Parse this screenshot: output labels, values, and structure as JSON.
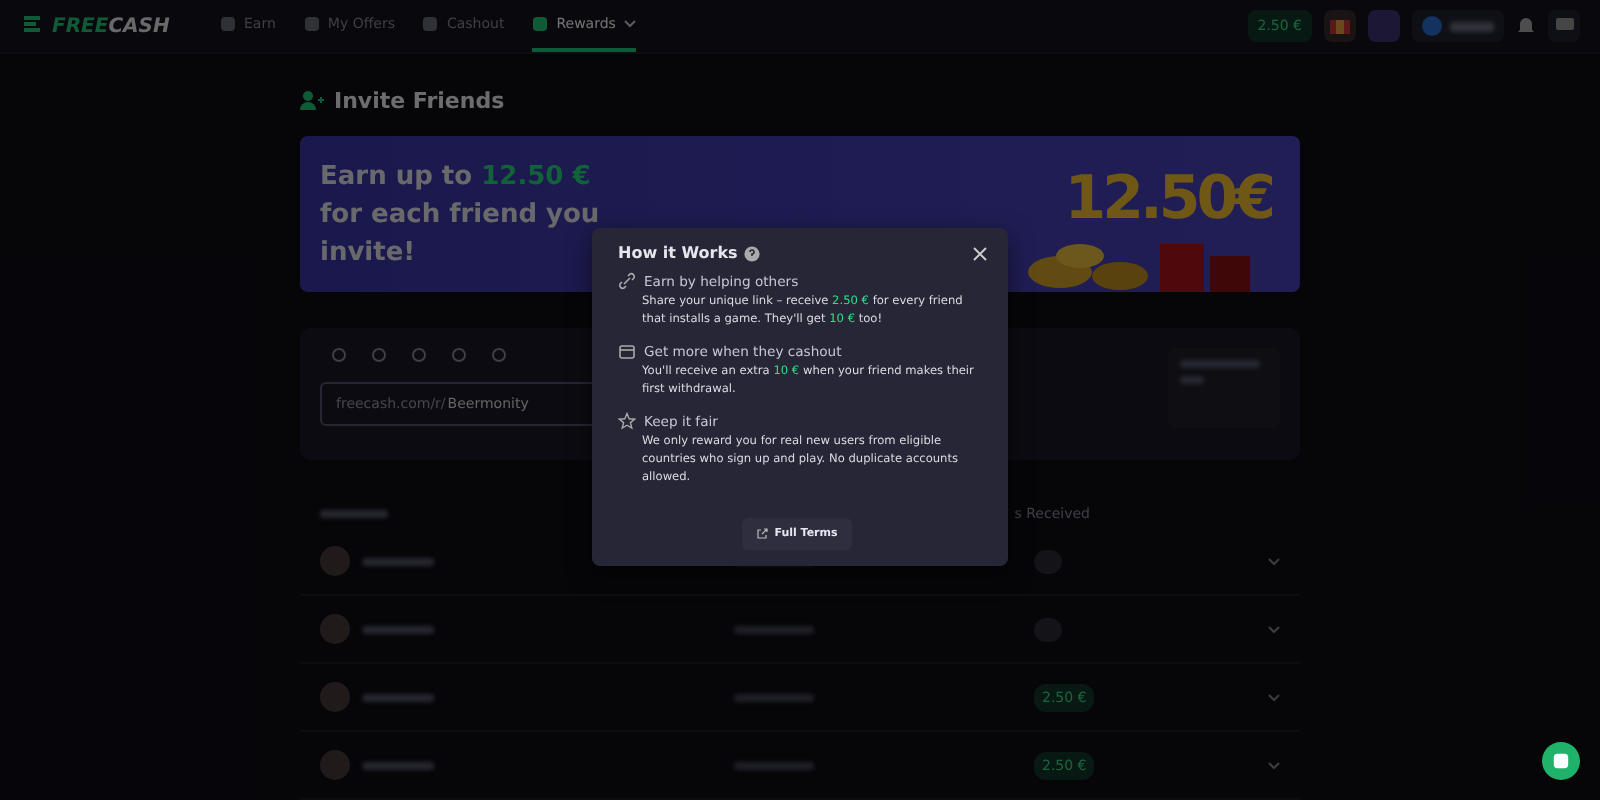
{
  "nav": {
    "logo": {
      "part_1": "FREE",
      "part_2": "CASH"
    },
    "links": [
      {
        "label": "Earn",
        "selected": false
      },
      {
        "label": "My Offers",
        "selected": false
      },
      {
        "label": "Cashout",
        "selected": false
      },
      {
        "label": "Rewards",
        "selected": true
      }
    ],
    "balance": "2.50 €"
  },
  "page_title": "Invite Friends",
  "banner": {
    "text_start": "Earn up to ",
    "amount": "12.50 €",
    "text_end": " for each friend you invite!",
    "art_text": "12.50€"
  },
  "share": {
    "link_prefix": "freecash.com/r/",
    "link_code": "Beermonity"
  },
  "friends": {
    "column_header": "s Received",
    "rows": [
      {
        "reward": null
      },
      {
        "reward": null
      },
      {
        "reward": "2.50 €"
      },
      {
        "reward": "2.50 €"
      }
    ]
  },
  "modal": {
    "title": "How it Works",
    "items": [
      {
        "kind": "link",
        "heading": "Earn by helping others",
        "body": [
          {
            "text": "Share your unique link – receive ",
            "highlight": false
          },
          {
            "text": "2.50 €",
            "highlight": true
          },
          {
            "text": " for every friend that installs a game. They'll get ",
            "highlight": false
          },
          {
            "text": "10 €",
            "highlight": true
          },
          {
            "text": " too!",
            "highlight": false
          }
        ]
      },
      {
        "kind": "wallet",
        "heading": "Get more when they cashout",
        "body": [
          {
            "text": "You'll receive an extra ",
            "highlight": false
          },
          {
            "text": "10 €",
            "highlight": true
          },
          {
            "text": " when your friend makes their first withdrawal.",
            "highlight": false
          }
        ]
      },
      {
        "kind": "star",
        "heading": "Keep it fair",
        "body": [
          {
            "text": "We only reward you for real new users from eligible countries who sign up and play. No duplicate accounts allowed.",
            "highlight": false
          }
        ]
      }
    ],
    "button": "Full Terms"
  }
}
